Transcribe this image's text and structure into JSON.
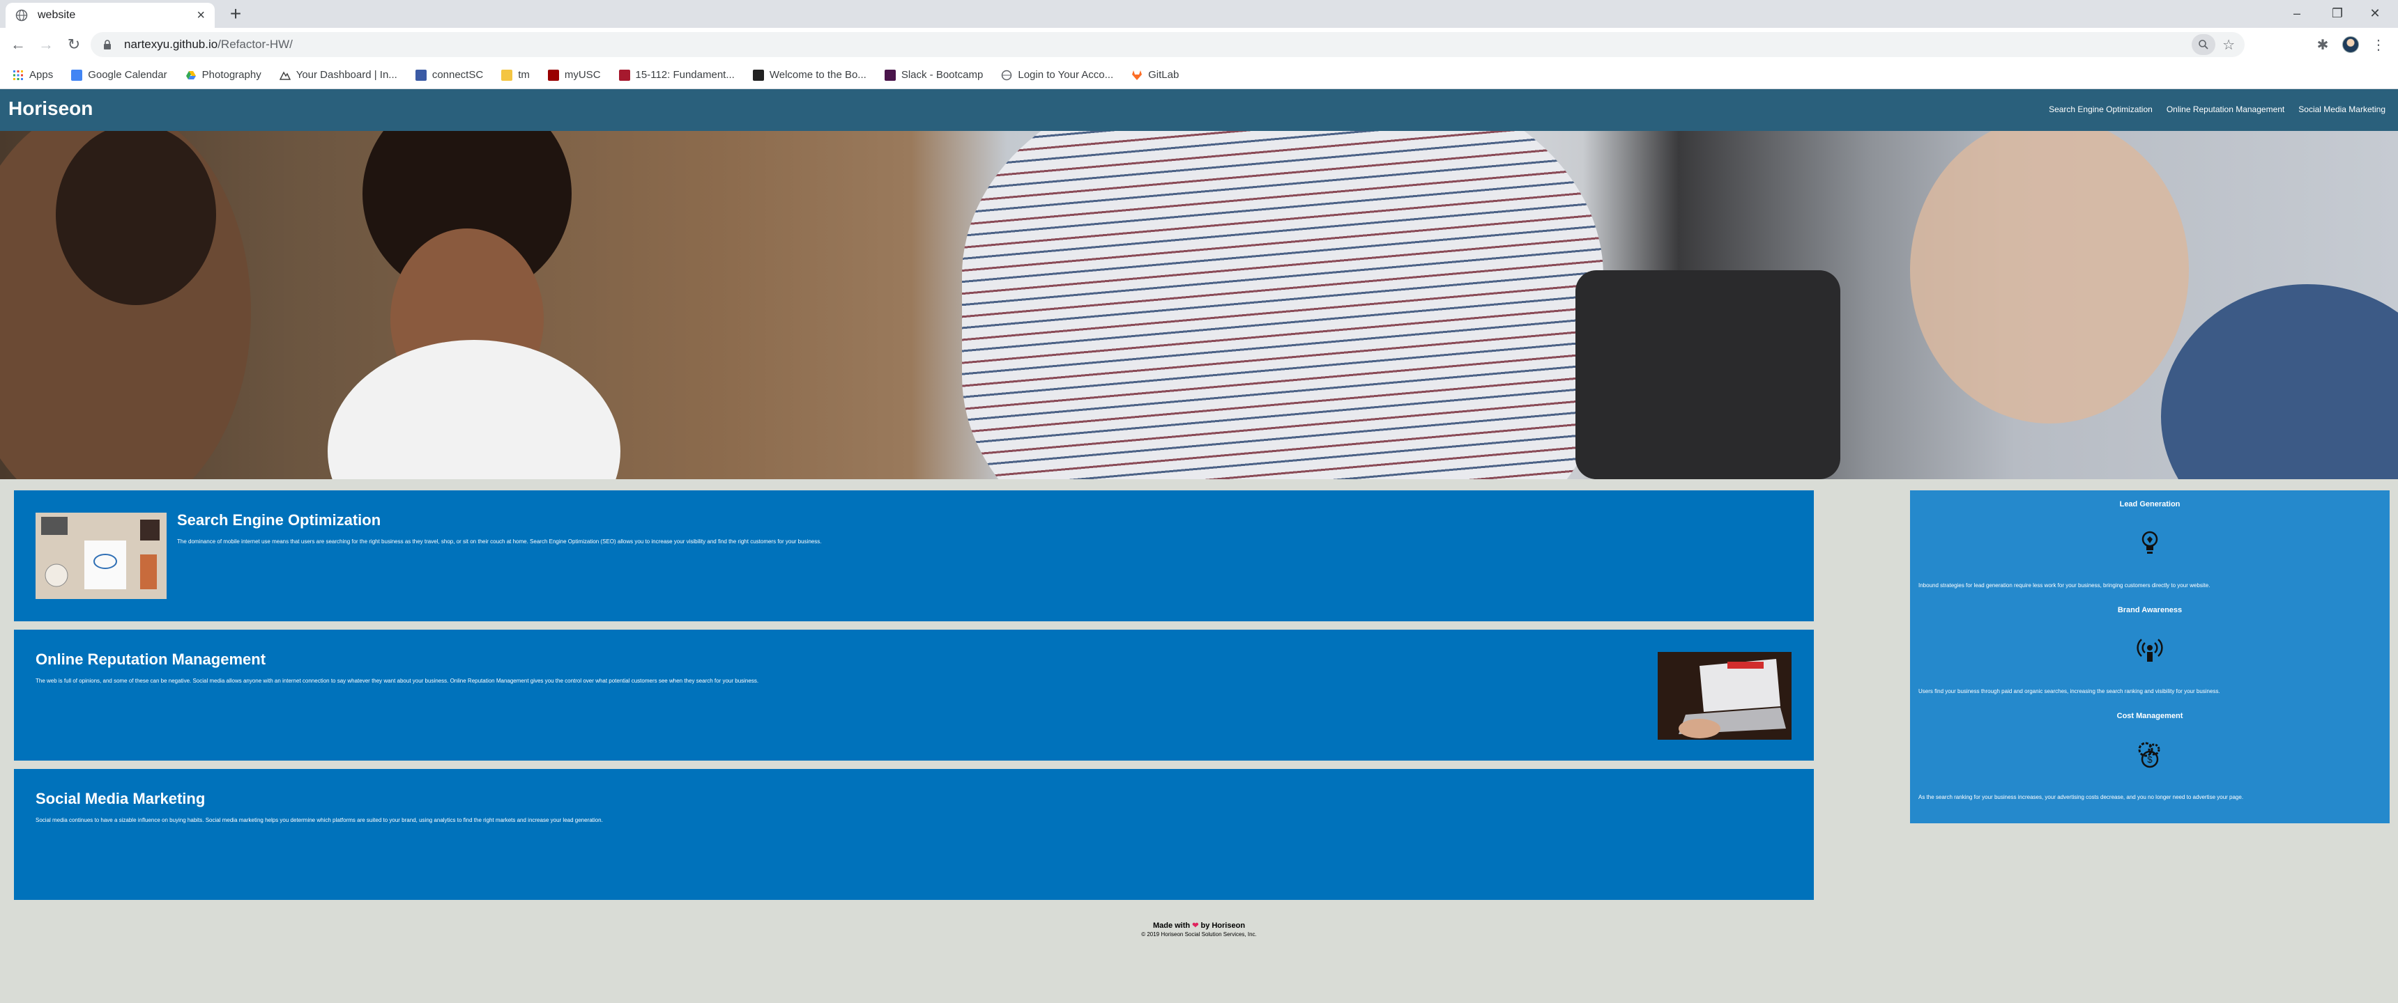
{
  "browser": {
    "tab_title": "website",
    "new_tab": "+",
    "url_host": "nartexyu.github.io",
    "url_path": "/Refactor-HW/",
    "window_controls": [
      "–",
      "❐",
      "✕"
    ],
    "bookmarks": [
      {
        "label": "Apps",
        "icon": "apps-grid-icon",
        "color": "#4285f4"
      },
      {
        "label": "Google Calendar",
        "icon": "calendar-icon",
        "color": "#4285f4"
      },
      {
        "label": "Photography",
        "icon": "drive-icon",
        "color": "#34a853"
      },
      {
        "label": "Your Dashboard | In...",
        "icon": "mountain-icon",
        "color": "#444444"
      },
      {
        "label": "connectSC",
        "icon": "connectsc-icon",
        "color": "#3b5ba5"
      },
      {
        "label": "tm",
        "icon": "folder-icon",
        "color": "#f4c542"
      },
      {
        "label": "myUSC",
        "icon": "usc-icon",
        "color": "#990000"
      },
      {
        "label": "15-112: Fundament...",
        "icon": "cmu-icon",
        "color": "#a6192e"
      },
      {
        "label": "Welcome to the Bo...",
        "icon": "book-icon",
        "color": "#222222"
      },
      {
        "label": "Slack - Bootcamp",
        "icon": "slack-icon",
        "color": "#4a154b"
      },
      {
        "label": "Login to Your Acco...",
        "icon": "globe-icon",
        "color": "#5f6368"
      },
      {
        "label": "GitLab",
        "icon": "gitlab-icon",
        "color": "#fc6d26"
      }
    ]
  },
  "site": {
    "logo": "Horiseon",
    "nav": [
      "Search Engine Optimization",
      "Online Reputation Management",
      "Social Media Marketing"
    ]
  },
  "content": [
    {
      "title": "Search Engine Optimization",
      "text": "The dominance of mobile internet use means that users are searching for the right business as they travel, shop, or sit on their couch at home. Search Engine Optimization (SEO) allows you to increase your visibility and find the right customers for your business."
    },
    {
      "title": "Online Reputation Management",
      "text": "The web is full of opinions, and some of these can be negative. Social media allows anyone with an internet connection to say whatever they want about your business. Online Reputation Management gives you the control over what potential customers see when they search for your business."
    },
    {
      "title": "Social Media Marketing",
      "text": "Social media continues to have a sizable influence on buying habits. Social media marketing helps you determine which platforms are suited to your brand, using analytics to find the right markets and increase your lead generation."
    }
  ],
  "benefits": [
    {
      "title": "Lead Generation",
      "icon": "lightbulb-icon",
      "text": "Inbound strategies for lead generation require less work for your business, bringing customers directly to your website."
    },
    {
      "title": "Brand Awareness",
      "icon": "broadcast-icon",
      "text": "Users find your business through paid and organic searches, increasing the search ranking and visibility for your business."
    },
    {
      "title": "Cost Management",
      "icon": "gears-money-icon",
      "text": "As the search ranking for your business increases, your advertising costs decrease, and you no longer need to advertise your page."
    }
  ],
  "footer": {
    "made_prefix": "Made with",
    "heart": "❤",
    "made_suffix": "by Horiseon",
    "copyright": "© 2019 Horiseon Social Solution Services, Inc."
  },
  "colors": {
    "header": "#2a607c",
    "card": "#0072bb",
    "sidebar": "#2589cc",
    "page_bg": "#d9dcd6"
  }
}
